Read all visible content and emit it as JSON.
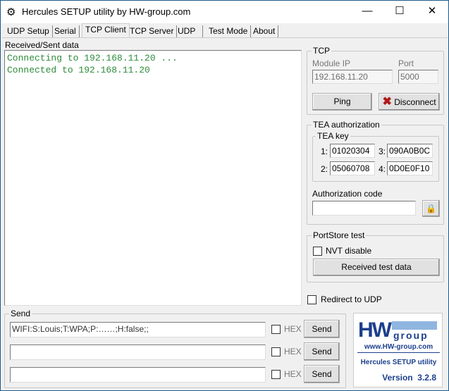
{
  "window": {
    "title": "Hercules SETUP utility by HW-group.com",
    "minimize": "—",
    "maximize": "☐",
    "close": "✕"
  },
  "tabs": [
    {
      "label": "UDP Setup"
    },
    {
      "label": "Serial"
    },
    {
      "label": "TCP Client"
    },
    {
      "label": "TCP Server"
    },
    {
      "label": "UDP"
    },
    {
      "label": "Test Mode"
    },
    {
      "label": "About"
    }
  ],
  "received": {
    "label": "Received/Sent data",
    "lines": [
      "Connecting to 192.168.11.20 ...",
      "Connected to 192.168.11.20"
    ]
  },
  "tcp": {
    "title": "TCP",
    "module_ip_label": "Module IP",
    "module_ip": "192.168.11.20",
    "port_label": "Port",
    "port": "5000",
    "ping": "Ping",
    "disconnect": "Disconnect"
  },
  "tea": {
    "title": "TEA authorization",
    "key_title": "TEA key",
    "keys": [
      {
        "n": "1:",
        "v": "01020304"
      },
      {
        "n": "2:",
        "v": "05060708"
      },
      {
        "n": "3:",
        "v": "090A0B0C"
      },
      {
        "n": "4:",
        "v": "0D0E0F10"
      }
    ],
    "auth_label": "Authorization code",
    "auth_value": ""
  },
  "portstore": {
    "title": "PortStore test",
    "nvt": "NVT disable",
    "received_test": "Received test data"
  },
  "redirect": "Redirect to UDP",
  "send": {
    "title": "Send",
    "rows": [
      {
        "value": "WIFI:S:Louis;T:WPA;P:……;H:false;;",
        "hex": "HEX",
        "button": "Send"
      },
      {
        "value": "",
        "hex": "HEX",
        "button": "Send"
      },
      {
        "value": "",
        "hex": "HEX",
        "button": "Send"
      }
    ]
  },
  "logo": {
    "brand": "HW group",
    "url": "www.HW-group.com",
    "product": "Hercules SETUP utility",
    "version": "Version  3.2.8"
  }
}
